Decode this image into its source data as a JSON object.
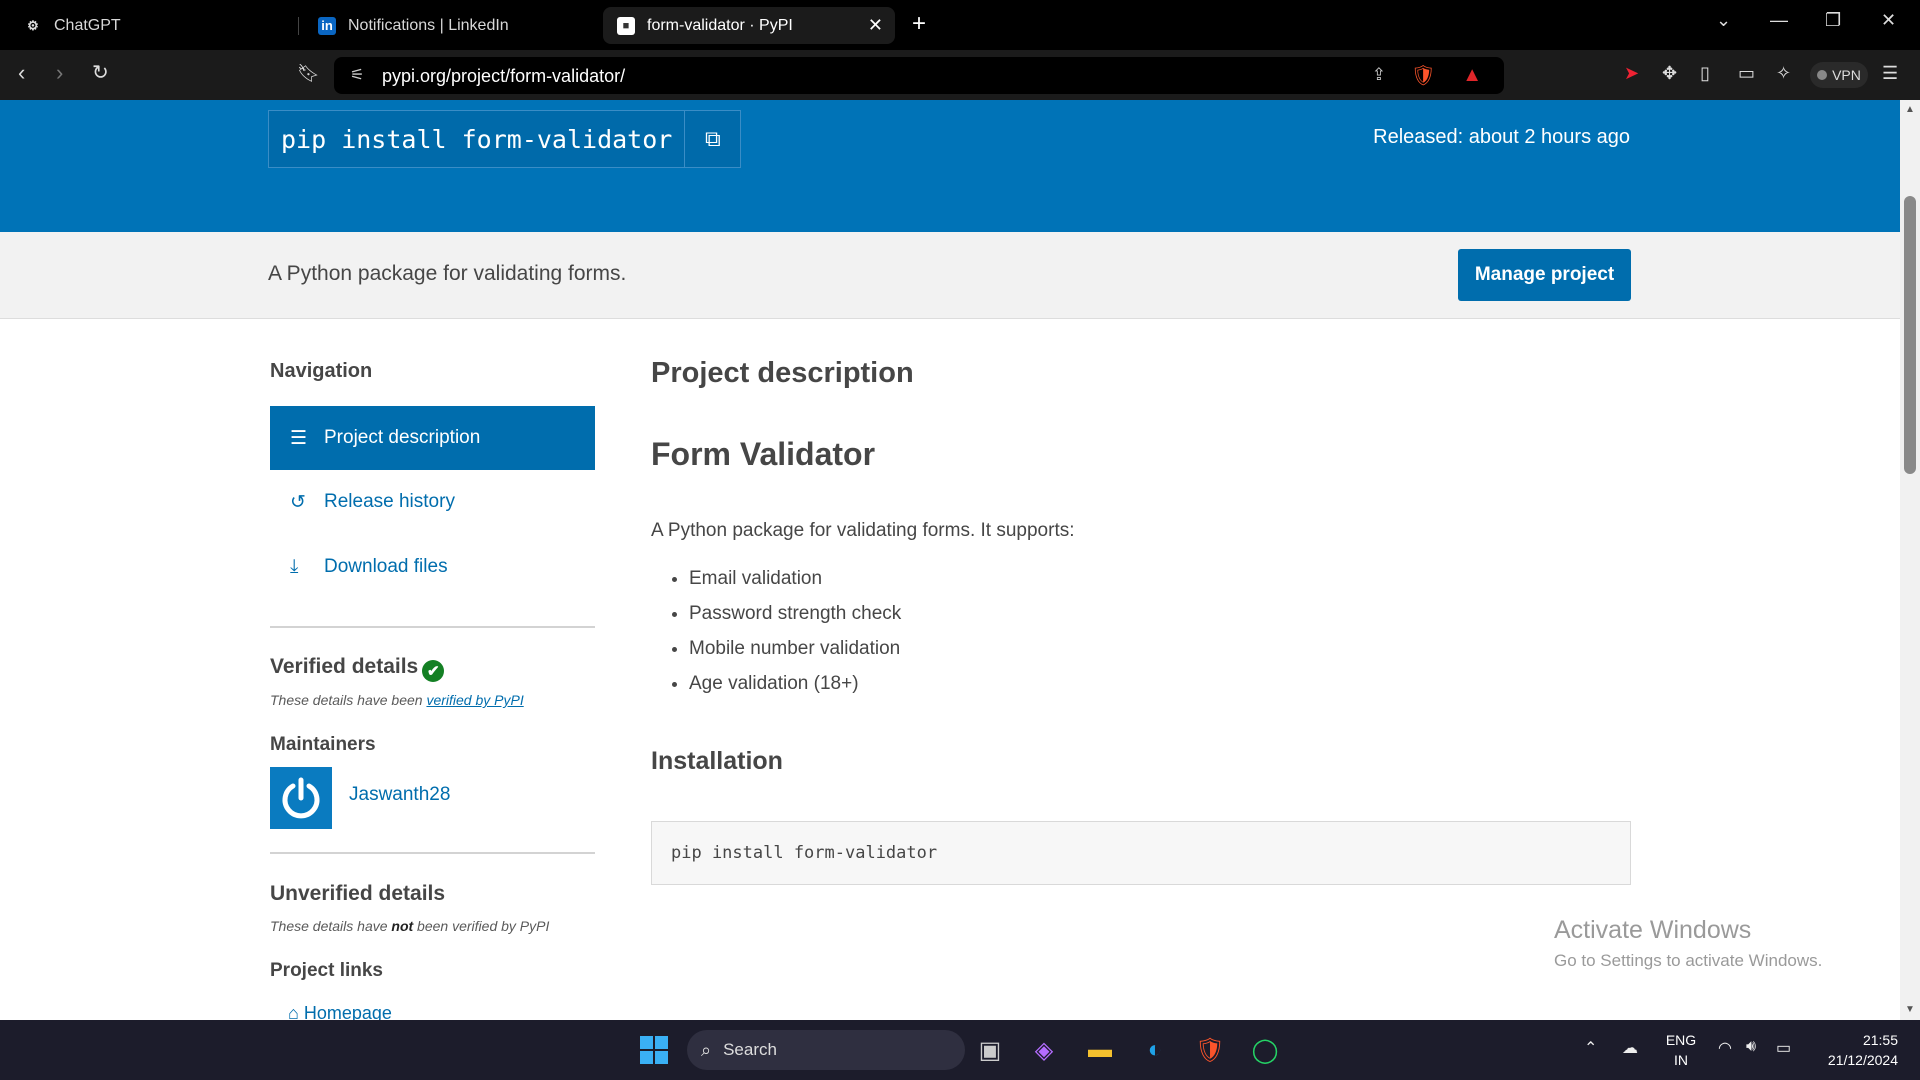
{
  "browser": {
    "tabs": [
      {
        "title": "ChatGPT",
        "icon": "chatgpt-icon"
      },
      {
        "title": "Notifications | LinkedIn",
        "icon": "linkedin-icon"
      },
      {
        "title": "form-validator · PyPI",
        "icon": "pypi-icon",
        "active": true
      }
    ],
    "url": "pypi.org/project/form-validator/",
    "vpn_label": "VPN"
  },
  "hero": {
    "pip_command": "pip install form-validator",
    "released": "Released: about 2 hours ago"
  },
  "summary": {
    "text": "A Python package for validating forms.",
    "manage_label": "Manage project"
  },
  "sidebar": {
    "nav_heading": "Navigation",
    "nav_items": [
      {
        "label": "Project description",
        "icon": "list-icon",
        "active": true
      },
      {
        "label": "Release history",
        "icon": "history-icon"
      },
      {
        "label": "Download files",
        "icon": "download-icon"
      }
    ],
    "verified_heading": "Verified details",
    "verified_note_prefix": "These details have been ",
    "verified_note_link": "verified by PyPI",
    "maintainers_heading": "Maintainers",
    "maintainer_name": "Jaswanth28",
    "unverified_heading": "Unverified details",
    "unverified_note_prefix": "These details have ",
    "unverified_note_bold": "not",
    "unverified_note_suffix": " been verified by PyPI",
    "project_links_heading": "Project links",
    "homepage_label": "Homepage"
  },
  "main": {
    "section_heading": "Project description",
    "title": "Form Validator",
    "intro": "A Python package for validating forms. It supports:",
    "features": [
      "Email validation",
      "Password strength check",
      "Mobile number validation",
      "Age validation (18+)"
    ],
    "install_heading": "Installation",
    "install_code": "pip install form-validator"
  },
  "watermark": {
    "line1": "Activate Windows",
    "line2": "Go to Settings to activate Windows."
  },
  "taskbar": {
    "search_label": "Search",
    "lang_line1": "ENG",
    "lang_line2": "IN",
    "time": "21:55",
    "date": "21/12/2024"
  },
  "colors": {
    "pypi_blue": "#0073b7",
    "link_blue": "#006dad",
    "verified_green": "#148024"
  }
}
